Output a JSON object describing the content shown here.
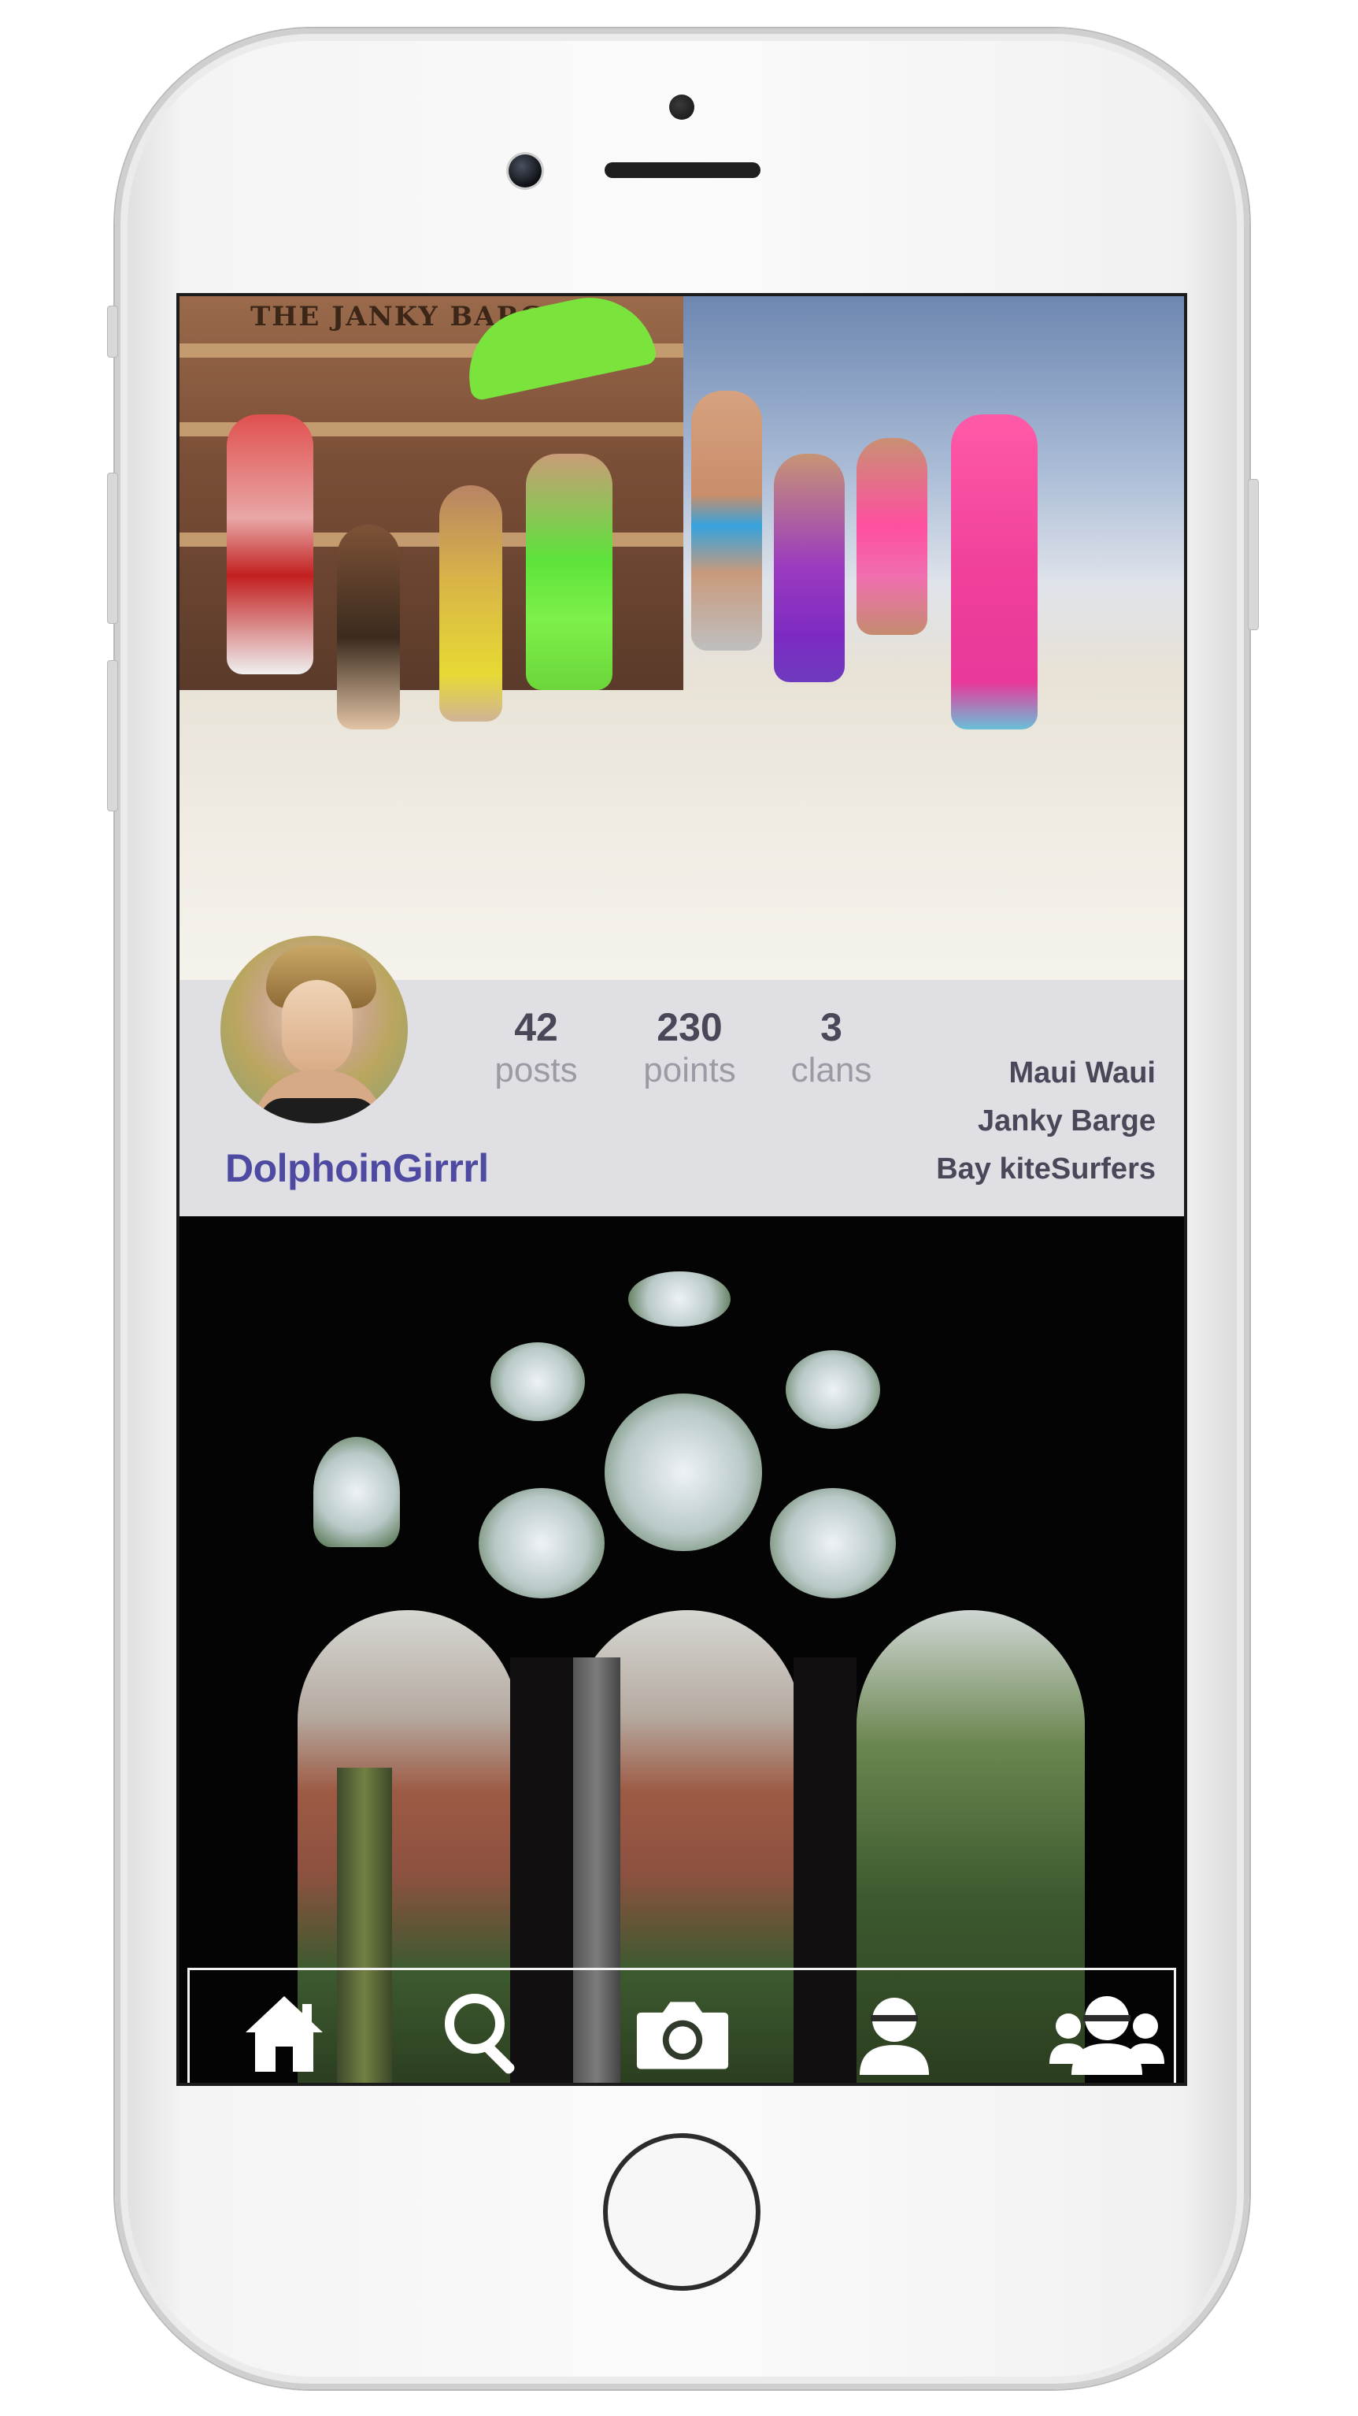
{
  "hero": {
    "barge_sign": "THE JANKY BARGE"
  },
  "profile": {
    "username": "DolphoinGirrrl",
    "stats": [
      {
        "value": "42",
        "label": "posts"
      },
      {
        "value": "230",
        "label": "points"
      },
      {
        "value": "3",
        "label": "clans"
      }
    ],
    "clans": [
      "Maui Waui",
      "Janky Barge",
      "Bay kiteSurfers"
    ]
  },
  "tabbar": {
    "items": [
      {
        "name": "home",
        "icon": "home-icon"
      },
      {
        "name": "search",
        "icon": "search-icon"
      },
      {
        "name": "camera",
        "icon": "camera-icon"
      },
      {
        "name": "profile",
        "icon": "user-icon"
      },
      {
        "name": "clans",
        "icon": "group-icon"
      }
    ]
  },
  "colors": {
    "username": "#4f4aa1",
    "stat_number": "#4a4759",
    "stat_label": "#9c9aa5",
    "profile_band": "#e0dfe4"
  }
}
